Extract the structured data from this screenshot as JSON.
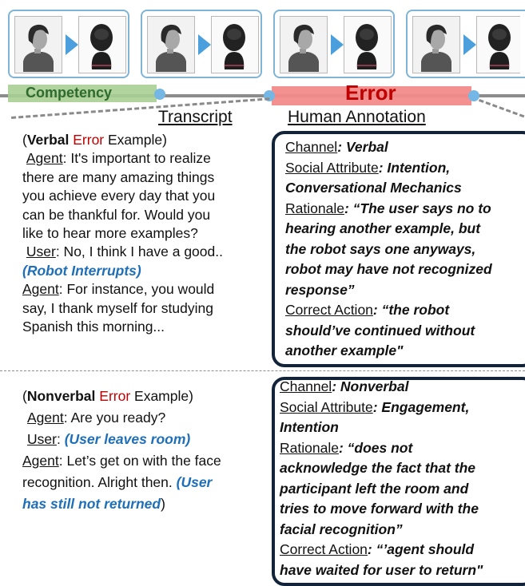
{
  "timeline": {
    "competency_label": "Competency",
    "error_label": "Error"
  },
  "headers": {
    "transcript": "Transcript",
    "annotation": "Human Annotation"
  },
  "verbal": {
    "title_open": "(",
    "title_kind": "Verbal",
    "title_error": " Error",
    "title_rest": " Example)",
    "agent1_label": "Agent",
    "agent1_lines": [
      ": It's important to realize",
      "there are many amazing things",
      "you achieve every day that you",
      "can be thankful for. Would you",
      "like to hear more examples?"
    ],
    "user_label": "User",
    "user_text": ":  No, I think I have a good..",
    "interrupt": "(Robot Interrupts)",
    "agent2_label": "Agent",
    "agent2_lines": [
      ": For instance, you would",
      "say, I thank myself for studying",
      "Spanish this morning..."
    ]
  },
  "verbal_annotation": {
    "channel_label": "Channel",
    "channel_value": ": Verbal",
    "social_label": "Social Attribute",
    "social_value_1": ": Intention,",
    "social_value_2": "Conversational Mechanics",
    "rationale_label": "Rationale",
    "rationale_lines": [
      ": “The user says no to",
      "hearing another example, but",
      "the robot says one anyways,",
      "robot may have not recognized",
      "response”"
    ],
    "action_label": "Correct Action",
    "action_lines": [
      ": “the robot",
      "should’ve continued without",
      "another example\""
    ]
  },
  "nonverbal": {
    "title_open": "(",
    "title_kind": "Nonverbal",
    "title_error": " Error",
    "title_rest": " Example)",
    "agent1_label": "Agent",
    "agent1_text": ": Are you ready?",
    "user_label": "User",
    "user_colon": ": ",
    "user_action": "(User leaves room)",
    "agent2_label": "Agent",
    "agent2_line1": ": Let’s get on with the face",
    "agent2_line2_plain": "recognition. Alright then. ",
    "agent2_action_1": "(User",
    "agent2_action_2": "has still not returned",
    "agent2_action_close": ")"
  },
  "nonverbal_annotation": {
    "channel_label": "Channel",
    "channel_value": ": Nonverbal",
    "social_label": "Social Attribute",
    "social_value_1": ": Engagement,",
    "social_value_2": "Intention",
    "rationale_label": "Rationale",
    "rationale_lines": [
      ": “does not",
      "acknowledge the fact that the",
      "participant left the room and",
      "tries to move forward with the",
      "facial recognition”"
    ],
    "action_label": "Correct Action",
    "action_lines": [
      ": “’agent should",
      "have waited for user to return\""
    ]
  },
  "colors": {
    "competency": "#a9cf93",
    "error_bar": "#f28a8a",
    "error_text": "#c00000",
    "highlight_blue": "#1f6fb8",
    "box_border": "#13243a",
    "frame_border": "#7fb4d6"
  }
}
